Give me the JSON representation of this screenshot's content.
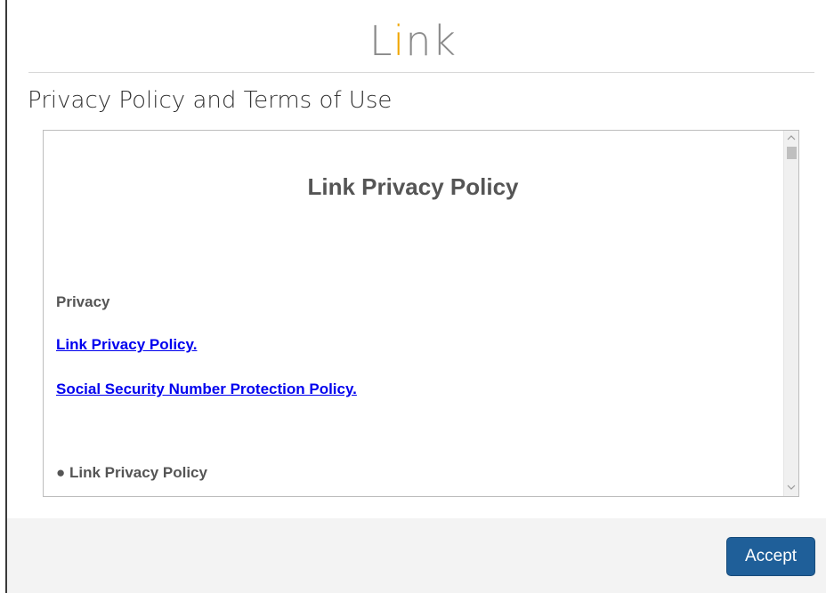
{
  "app": {
    "logo_prefix": "L",
    "logo_accent": "i",
    "logo_suffix": "nk",
    "accent_color": "#f0a500",
    "button_color": "#1f5f99"
  },
  "page": {
    "title": "Privacy Policy and Terms of Use"
  },
  "policy": {
    "heading": "Link Privacy Policy",
    "section_label": "Privacy",
    "links": [
      "Link Privacy Policy.",
      "Social Security Number Protection Policy."
    ],
    "bullet_items": [
      "● Link Privacy Policy"
    ]
  },
  "scrollbar": {
    "up_icon": "chevron-up-icon",
    "down_icon": "chevron-down-icon"
  },
  "footer": {
    "accept_label": "Accept"
  }
}
